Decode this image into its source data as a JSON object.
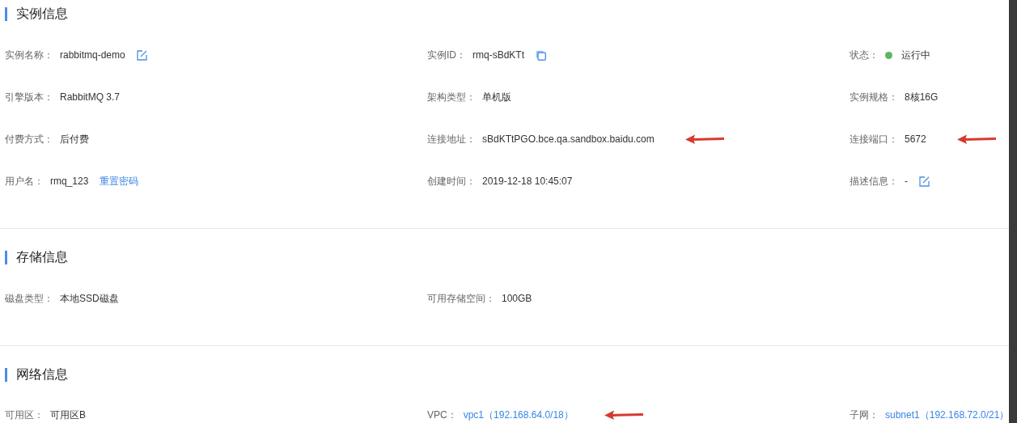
{
  "sections": [
    {
      "title": "实例信息",
      "fields": [
        {
          "label": "实例名称：",
          "value": "rabbitmq-demo",
          "kind": "editable",
          "annotated": false
        },
        {
          "label": "实例ID：",
          "value": "rmq-sBdKTt",
          "kind": "copyable",
          "annotated": false
        },
        {
          "label": "状态：",
          "value": "运行中",
          "kind": "status",
          "color": "#5fb466",
          "annotated": false
        },
        {
          "label": "引擎版本：",
          "value": "RabbitMQ 3.7",
          "kind": "text",
          "annotated": false
        },
        {
          "label": "架构类型：",
          "value": "单机版",
          "kind": "text",
          "annotated": false
        },
        {
          "label": "实例规格：",
          "value": "8核16G",
          "kind": "text",
          "annotated": false
        },
        {
          "label": "付费方式：",
          "value": "后付费",
          "kind": "text",
          "annotated": false
        },
        {
          "label": "连接地址：",
          "value": "sBdKTtPGO.bce.qa.sandbox.baidu.com",
          "kind": "text",
          "annotated": true
        },
        {
          "label": "连接端口：",
          "value": "5672",
          "kind": "text",
          "annotated": true
        },
        {
          "label": "用户名：",
          "value": "rmq_123",
          "kind": "text",
          "action": "重置密码",
          "annotated": false
        },
        {
          "label": "创建时间：",
          "value": "2019-12-18 10:45:07",
          "kind": "text",
          "annotated": false
        },
        {
          "label": "描述信息：",
          "value": "-",
          "kind": "editable",
          "annotated": false
        }
      ]
    },
    {
      "title": "存储信息",
      "fields": [
        {
          "label": "磁盘类型：",
          "value": "本地SSD磁盘",
          "kind": "text",
          "annotated": false
        },
        {
          "label": "可用存储空间：",
          "value": "100GB",
          "kind": "text",
          "annotated": false
        }
      ]
    },
    {
      "title": "网络信息",
      "fields": [
        {
          "label": "可用区：",
          "value": "可用区B",
          "kind": "text",
          "annotated": false
        },
        {
          "label": "VPC：",
          "value": "vpc1（192.168.64.0/18）",
          "kind": "link",
          "annotated": true
        },
        {
          "label": "子网：",
          "value": "subnet1（192.168.72.0/21）",
          "kind": "link",
          "annotated": false
        }
      ]
    }
  ]
}
